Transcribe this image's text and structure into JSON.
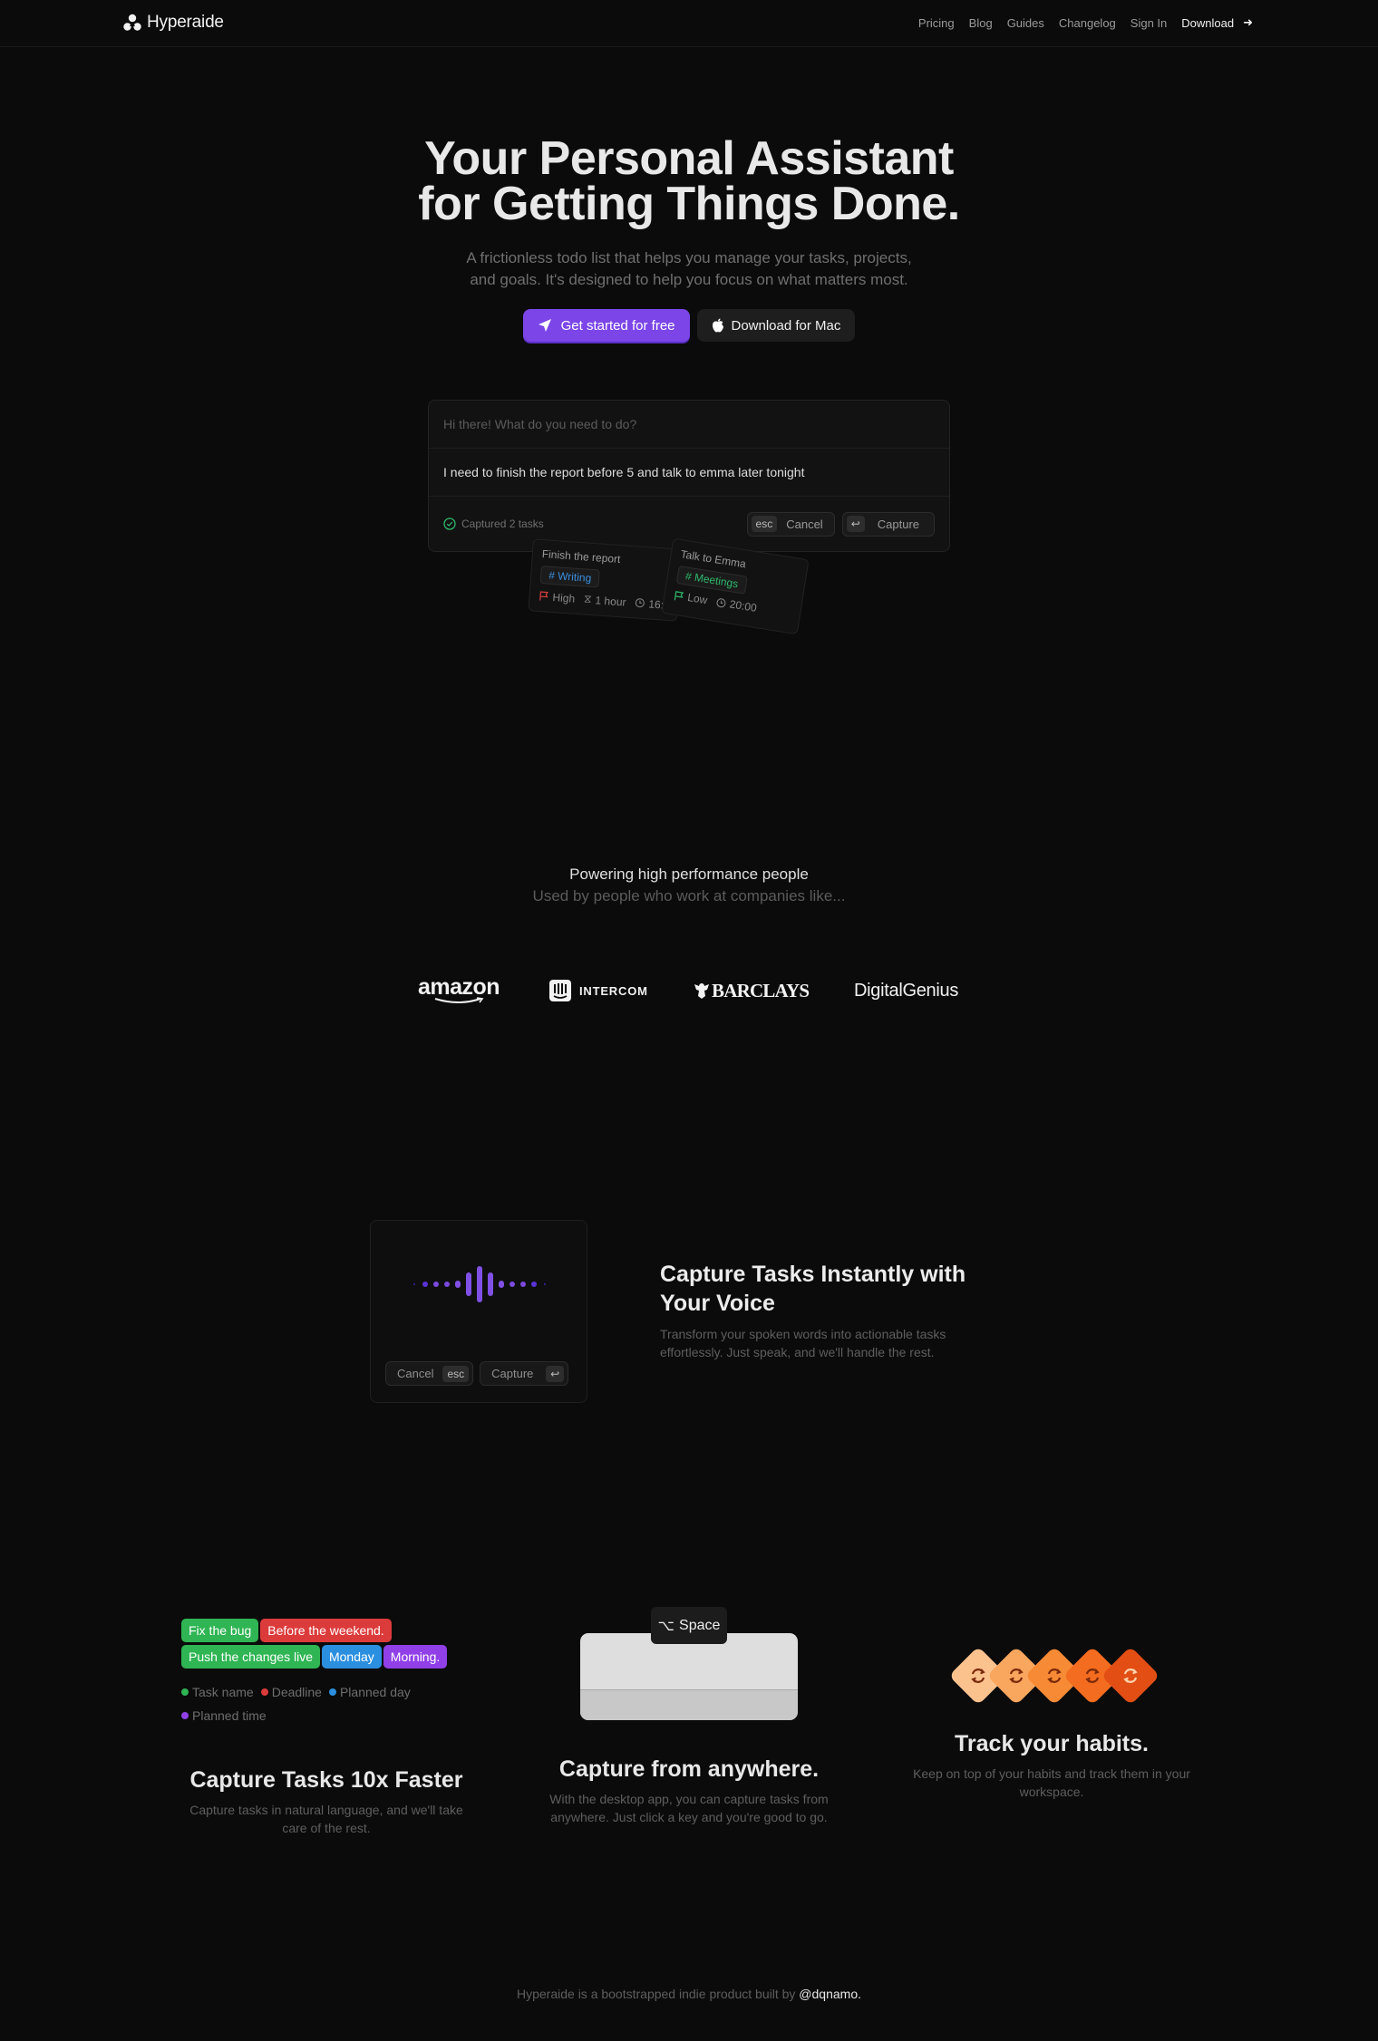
{
  "nav": {
    "brand": "Hyperaide",
    "links": [
      {
        "label": "Pricing"
      },
      {
        "label": "Blog"
      },
      {
        "label": "Guides"
      },
      {
        "label": "Changelog"
      },
      {
        "label": "Sign In"
      }
    ],
    "download_label": "Download"
  },
  "hero": {
    "title_line1": "Your Personal Assistant",
    "title_line2": "for Getting Things Done.",
    "subtitle_line1": "A frictionless todo list that helps you manage your tasks, projects,",
    "subtitle_line2": "and goals. It's designed to help you focus on what matters most.",
    "cta_primary": "Get started for free",
    "cta_secondary": "Download for Mac",
    "accent": "#7b45e8"
  },
  "capture_demo": {
    "placeholder": "Hi there! What do you need to do?",
    "input_value": "I need to finish the report before 5 and talk to emma later tonight",
    "status": "Captured 2 tasks",
    "cancel_key": "esc",
    "cancel_label": "Cancel",
    "capture_key": "↩",
    "capture_label": "Capture",
    "tasks": [
      {
        "title": "Finish the report",
        "tag": "Writing",
        "tag_color": "#3b8fe0",
        "priority": "High",
        "priority_color": "#d94040",
        "duration": "1 hour",
        "time": "16:00"
      },
      {
        "title": "Talk to Emma",
        "tag": "Meetings",
        "tag_color": "#2eb86a",
        "priority": "Low",
        "priority_color": "#2eb86a",
        "time": "20:00"
      }
    ]
  },
  "social_proof": {
    "title": "Powering high performance people",
    "subtitle": "Used by people who work at companies like...",
    "companies": [
      "amazon",
      "INTERCOM",
      "BARCLAYS",
      "DigitalGenius"
    ]
  },
  "voice": {
    "title": "Capture Tasks Instantly with Your Voice",
    "description": "Transform your spoken words into actionable tasks effortlessly. Just speak, and we'll handle the rest.",
    "cancel_label": "Cancel",
    "cancel_key": "esc",
    "capture_label": "Capture",
    "capture_key": "↩"
  },
  "features": [
    {
      "title": "Capture Tasks 10x Faster",
      "description": "Capture tasks in natural language, and we'll take care of the rest.",
      "chips_row1": [
        {
          "text": "Fix the bug",
          "color": "#2fb553"
        },
        {
          "text": "Before the weekend.",
          "color": "#dc3b3b"
        }
      ],
      "chips_row2": [
        {
          "text": "Push the changes live",
          "color": "#2fb553"
        },
        {
          "text": "Monday",
          "color": "#2b8fe0"
        },
        {
          "text": "Morning.",
          "color": "#9140e8"
        }
      ],
      "legend": [
        {
          "label": "Task name",
          "color": "#2fb553"
        },
        {
          "label": "Deadline",
          "color": "#dc3b3b"
        },
        {
          "label": "Planned day",
          "color": "#2b8fe0"
        },
        {
          "label": "Planned time",
          "color": "#9140e8"
        }
      ]
    },
    {
      "title": "Capture from anywhere.",
      "description": "With the desktop app, you can capture tasks from anywhere. Just click a key and you're good to go.",
      "shortcut_symbol": "⌥",
      "shortcut_key": "Space"
    },
    {
      "title": "Track your habits.",
      "description": "Keep on top of your habits and track them in your workspace.",
      "habit_colors": [
        "#fcc28e",
        "#f9a65e",
        "#f78a35",
        "#f46c1f",
        "#e24e14"
      ]
    }
  ],
  "footer": {
    "text": "Hyperaide is a bootstrapped indie product built by",
    "handle": "@dqnamo."
  }
}
